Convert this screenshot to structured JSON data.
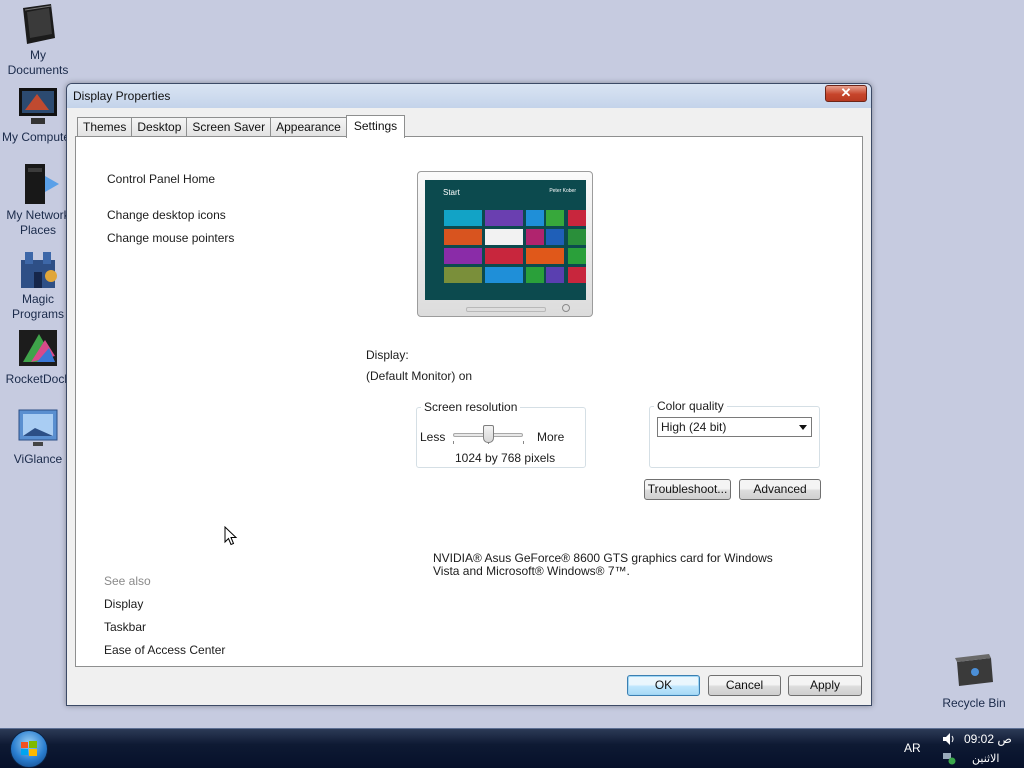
{
  "desktop": {
    "icons": [
      {
        "label1": "My",
        "label2": "Documents"
      },
      {
        "label1": "My Computer",
        "label2": ""
      },
      {
        "label1": "My Network",
        "label2": "Places"
      },
      {
        "label1": "Magic",
        "label2": "Programs"
      },
      {
        "label1": "RocketDock",
        "label2": ""
      },
      {
        "label1": "ViGlance",
        "label2": ""
      }
    ],
    "recycle_bin": "Recycle Bin"
  },
  "window": {
    "title": "Display Properties",
    "close_glyph": "✕",
    "tabs": [
      "Themes",
      "Desktop",
      "Screen Saver",
      "Appearance",
      "Settings"
    ],
    "active_tab": "Settings"
  },
  "sidebar": {
    "home": "Control Panel Home",
    "links": [
      "Change desktop icons",
      "Change mouse pointers"
    ],
    "see_also_heading": "See also",
    "see_also": [
      "Display",
      "Taskbar",
      "Ease of Access Center"
    ]
  },
  "preview": {
    "start_label": "Start",
    "user_label": "Peter Kober"
  },
  "display": {
    "label": "Display:",
    "value": "(Default Monitor) on"
  },
  "resolution": {
    "legend": "Screen resolution",
    "less": "Less",
    "more": "More",
    "value_text": "1024 by 768 pixels",
    "slider_fraction": 0.5
  },
  "color_quality": {
    "legend": "Color quality",
    "selected": "High (24 bit)"
  },
  "buttons": {
    "troubleshoot": "Troubleshoot...",
    "advanced": "Advanced",
    "ok": "OK",
    "cancel": "Cancel",
    "apply": "Apply"
  },
  "adapter": {
    "line1": "NVIDIA® Asus GeForce® 8600 GTS graphics card for Windows",
    "line2": "Vista and Microsoft® Windows® 7™."
  },
  "taskbar": {
    "language": "AR",
    "time": "09:02 ص",
    "day": "الاثنين"
  },
  "colors": {
    "desktop_bg": "#c6cbe0",
    "taskbar": "#0e1a33",
    "default_button": "#bee6fd"
  }
}
